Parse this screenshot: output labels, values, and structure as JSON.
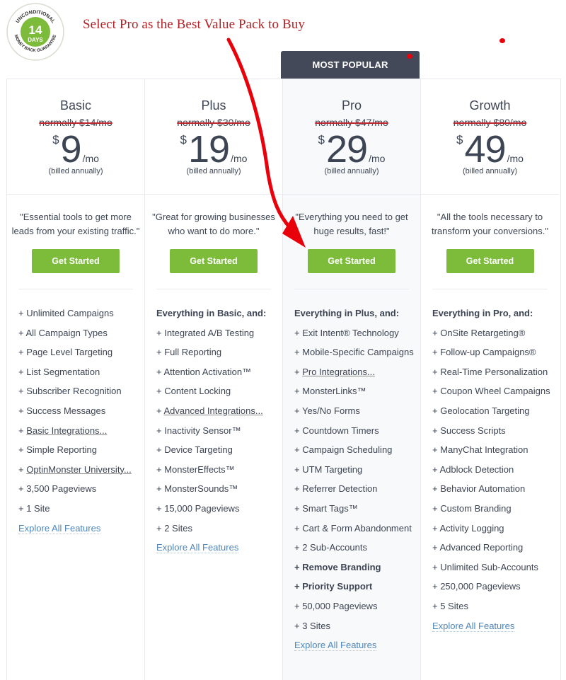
{
  "annotation": {
    "headline": "Select Pro as the Best Value Pack to Buy",
    "arrow_color": "#e8000b"
  },
  "badge": {
    "top_text": "UNCONDITIONAL",
    "number": "14",
    "unit": "DAYS",
    "bottom_text": "MONEY BACK GUARANTEE",
    "color": "#7cbc3a"
  },
  "popular_label": "MOST POPULAR",
  "colors": {
    "cta": "#7cbc3a",
    "link": "#4f86b8",
    "popular_bg": "#434959",
    "strike": "#c0262d"
  },
  "plans": [
    {
      "name": "Basic",
      "normally": "normally $14/mo",
      "currency": "$",
      "price": "9",
      "period": "/mo",
      "billing": "(billed annually)",
      "tagline": "\"Essential tools to get more leads from your existing traffic.\"",
      "cta": "Get Started",
      "features": [
        {
          "text": "+ Unlimited Campaigns"
        },
        {
          "text": "+ All Campaign Types"
        },
        {
          "text": "+ Page Level Targeting"
        },
        {
          "text": "+ List Segmentation"
        },
        {
          "text": "+ Subscriber Recognition"
        },
        {
          "text": "+ Success Messages"
        },
        {
          "prefix": "+ ",
          "link": "Basic Integrations..."
        },
        {
          "text": "+ Simple Reporting"
        },
        {
          "prefix": "+ ",
          "link": "OptinMonster University..."
        },
        {
          "text": "+ 3,500 Pageviews"
        },
        {
          "text": "+ 1 Site"
        }
      ],
      "explore": "Explore All Features"
    },
    {
      "name": "Plus",
      "normally": "normally $30/mo",
      "currency": "$",
      "price": "19",
      "period": "/mo",
      "billing": "(billed annually)",
      "tagline": "\"Great for growing businesses who want to do more.\"",
      "cta": "Get Started",
      "features": [
        {
          "text": "Everything in Basic, and:",
          "heading": true
        },
        {
          "text": "+ Integrated A/B Testing"
        },
        {
          "text": "+ Full Reporting"
        },
        {
          "text": "+ Attention Activation™"
        },
        {
          "text": "+ Content Locking"
        },
        {
          "prefix": "+ ",
          "link": "Advanced Integrations..."
        },
        {
          "text": "+ Inactivity Sensor™"
        },
        {
          "text": "+ Device Targeting"
        },
        {
          "text": "+ MonsterEffects™"
        },
        {
          "text": "+ MonsterSounds™"
        },
        {
          "text": "+ 15,000 Pageviews"
        },
        {
          "text": "+ 2 Sites"
        }
      ],
      "explore": "Explore All Features"
    },
    {
      "name": "Pro",
      "normally": "normally $47/mo",
      "currency": "$",
      "price": "29",
      "period": "/mo",
      "billing": "(billed annually)",
      "tagline": "\"Everything you need to get huge results, fast!\"",
      "cta": "Get Started",
      "features": [
        {
          "text": "Everything in Plus, and:",
          "heading": true
        },
        {
          "text": "+ Exit Intent® Technology"
        },
        {
          "text": "+ Mobile-Specific Campaigns"
        },
        {
          "prefix": "+ ",
          "link": "Pro Integrations..."
        },
        {
          "text": "+ MonsterLinks™"
        },
        {
          "text": "+ Yes/No Forms"
        },
        {
          "text": "+ Countdown Timers"
        },
        {
          "text": "+ Campaign Scheduling"
        },
        {
          "text": "+ UTM Targeting"
        },
        {
          "text": "+ Referrer Detection"
        },
        {
          "text": "+ Smart Tags™"
        },
        {
          "text": "+ Cart & Form Abandonment"
        },
        {
          "text": "+ 2 Sub-Accounts"
        },
        {
          "text": "+ Remove Branding",
          "bold": true
        },
        {
          "text": "+ Priority Support",
          "bold": true
        },
        {
          "text": "+ 50,000 Pageviews"
        },
        {
          "text": "+ 3 Sites"
        }
      ],
      "explore": "Explore All Features"
    },
    {
      "name": "Growth",
      "normally": "normally $80/mo",
      "currency": "$",
      "price": "49",
      "period": "/mo",
      "billing": "(billed annually)",
      "tagline": "\"All the tools necessary to transform your conversions.\"",
      "cta": "Get Started",
      "features": [
        {
          "text": "Everything in Pro, and:",
          "heading": true
        },
        {
          "text": "+ OnSite Retargeting®"
        },
        {
          "text": "+ Follow-up Campaigns®"
        },
        {
          "text": "+ Real-Time Personalization"
        },
        {
          "text": "+ Coupon Wheel Campaigns"
        },
        {
          "text": "+ Geolocation Targeting"
        },
        {
          "text": "+ Success Scripts"
        },
        {
          "text": "+ ManyChat Integration"
        },
        {
          "text": "+ Adblock Detection"
        },
        {
          "text": "+ Behavior Automation"
        },
        {
          "text": "+ Custom Branding"
        },
        {
          "text": "+ Activity Logging"
        },
        {
          "text": "+ Advanced Reporting"
        },
        {
          "text": "+ Unlimited Sub-Accounts"
        },
        {
          "text": "+ 250,000 Pageviews"
        },
        {
          "text": "+ 5 Sites"
        }
      ],
      "explore": "Explore All Features"
    }
  ]
}
